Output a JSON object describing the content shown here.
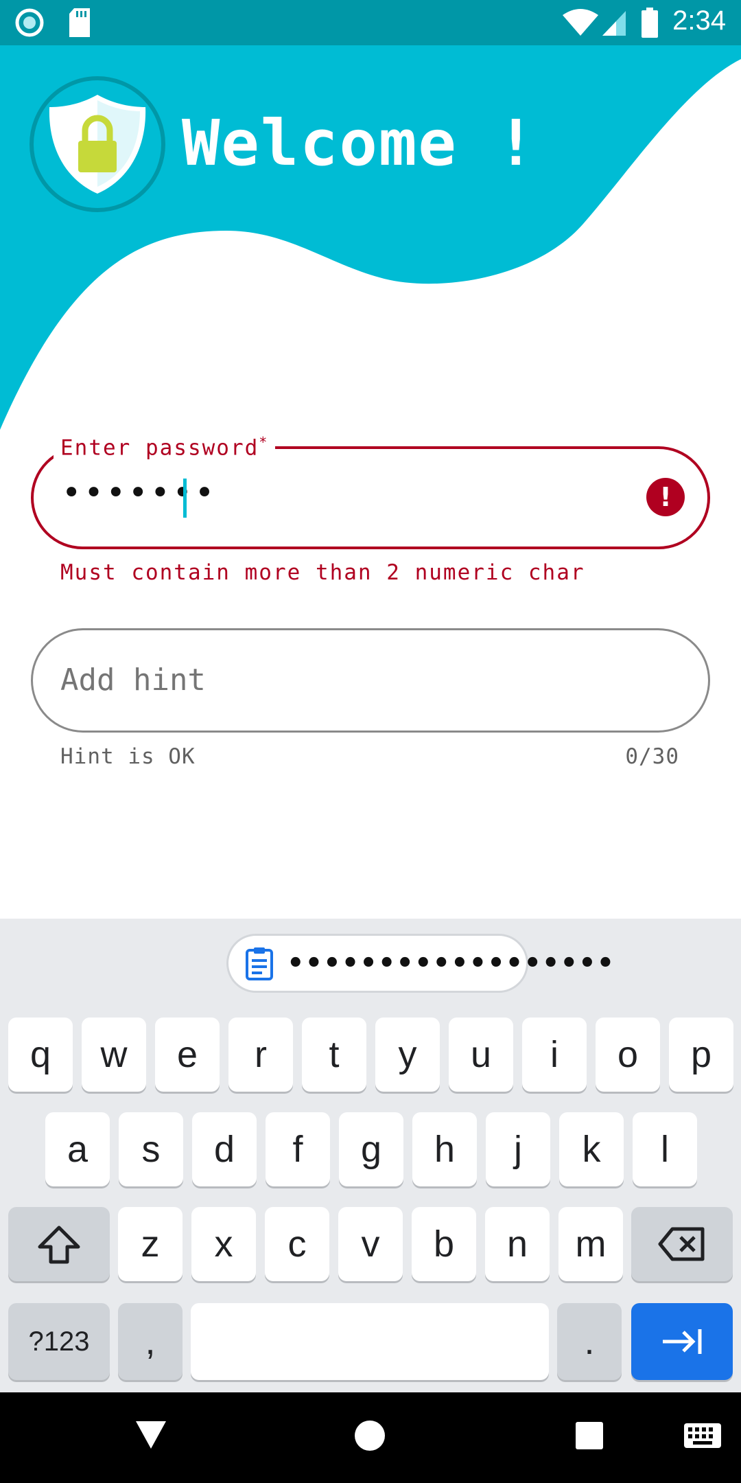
{
  "status_bar": {
    "time": "2:34"
  },
  "header": {
    "title": "Welcome !"
  },
  "password_field": {
    "label": "Enter password",
    "required_marker": "*",
    "masked_value": "•••••••",
    "error_text": "Must contain more than 2 numeric char"
  },
  "hint_field": {
    "placeholder": "Add hint",
    "helper_text": "Hint is OK",
    "counter": "0/30"
  },
  "keyboard": {
    "suggestion": "••••••••••••••••••",
    "row1": [
      "q",
      "w",
      "e",
      "r",
      "t",
      "y",
      "u",
      "i",
      "o",
      "p"
    ],
    "row2": [
      "a",
      "s",
      "d",
      "f",
      "g",
      "h",
      "j",
      "k",
      "l"
    ],
    "row3": [
      "z",
      "x",
      "c",
      "v",
      "b",
      "n",
      "m"
    ],
    "symbols_key": "?123",
    "comma_key": ",",
    "period_key": "."
  },
  "colors": {
    "accent": "#00bcd4",
    "status_bar": "#0097a7",
    "error": "#b00020",
    "keyboard_action": "#1a73e8"
  },
  "icons": [
    "sync-icon",
    "sd-card-icon",
    "wifi-icon",
    "signal-icon",
    "battery-icon",
    "shield-lock-icon",
    "error-icon",
    "clipboard-icon",
    "shift-icon",
    "backspace-icon",
    "tab-arrow-icon",
    "back-icon",
    "home-icon",
    "recents-icon",
    "keyboard-icon"
  ]
}
